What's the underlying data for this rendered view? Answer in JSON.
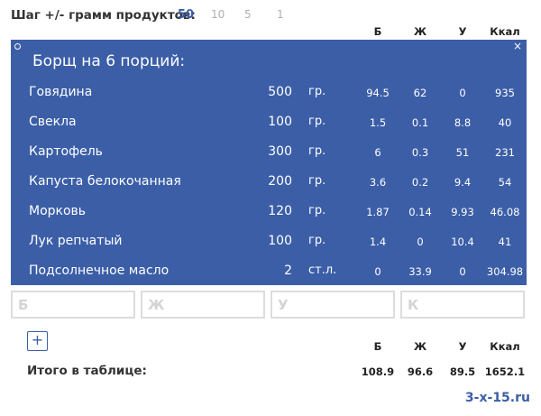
{
  "step": {
    "label": "Шаг +/- грамм продуктов:",
    "options": [
      "50",
      "10",
      "5",
      "1"
    ],
    "selected": "50"
  },
  "columns": [
    "Б",
    "Ж",
    "У",
    "Ккал"
  ],
  "recipe": {
    "title": "Борщ на 6 порций:",
    "close": "×",
    "items": [
      {
        "name": "Говядина",
        "qty": "500",
        "unit": "гр.",
        "b": "94.5",
        "zh": "62",
        "u": "0",
        "kcal": "935"
      },
      {
        "name": "Свекла",
        "qty": "100",
        "unit": "гр.",
        "b": "1.5",
        "zh": "0.1",
        "u": "8.8",
        "kcal": "40"
      },
      {
        "name": "Картофель",
        "qty": "300",
        "unit": "гр.",
        "b": "6",
        "zh": "0.3",
        "u": "51",
        "kcal": "231"
      },
      {
        "name": "Капуста белокочанная",
        "qty": "200",
        "unit": "гр.",
        "b": "3.6",
        "zh": "0.2",
        "u": "9.4",
        "kcal": "54"
      },
      {
        "name": "Морковь",
        "qty": "120",
        "unit": "гр.",
        "b": "1.87",
        "zh": "0.14",
        "u": "9.93",
        "kcal": "46.08"
      },
      {
        "name": "Лук репчатый",
        "qty": "100",
        "unit": "гр.",
        "b": "1.4",
        "zh": "0",
        "u": "10.4",
        "kcal": "41"
      },
      {
        "name": "Подсолнечное масло",
        "qty": "2",
        "unit": "ст.л.",
        "b": "0",
        "zh": "33.9",
        "u": "0",
        "kcal": "304.98"
      }
    ]
  },
  "inputs": {
    "b_placeholder": "Б",
    "zh_placeholder": "Ж",
    "u_placeholder": "У",
    "k_placeholder": "К"
  },
  "add_label": "+",
  "totals": {
    "label": "Итого в таблице:",
    "b": "108.9",
    "zh": "96.6",
    "u": "89.5",
    "kcal": "1652.1"
  },
  "brand": "3-x-15.ru",
  "colors": {
    "accent": "#3b5ea7",
    "panel_text": "#ffffff",
    "muted": "#b0b0b0"
  }
}
